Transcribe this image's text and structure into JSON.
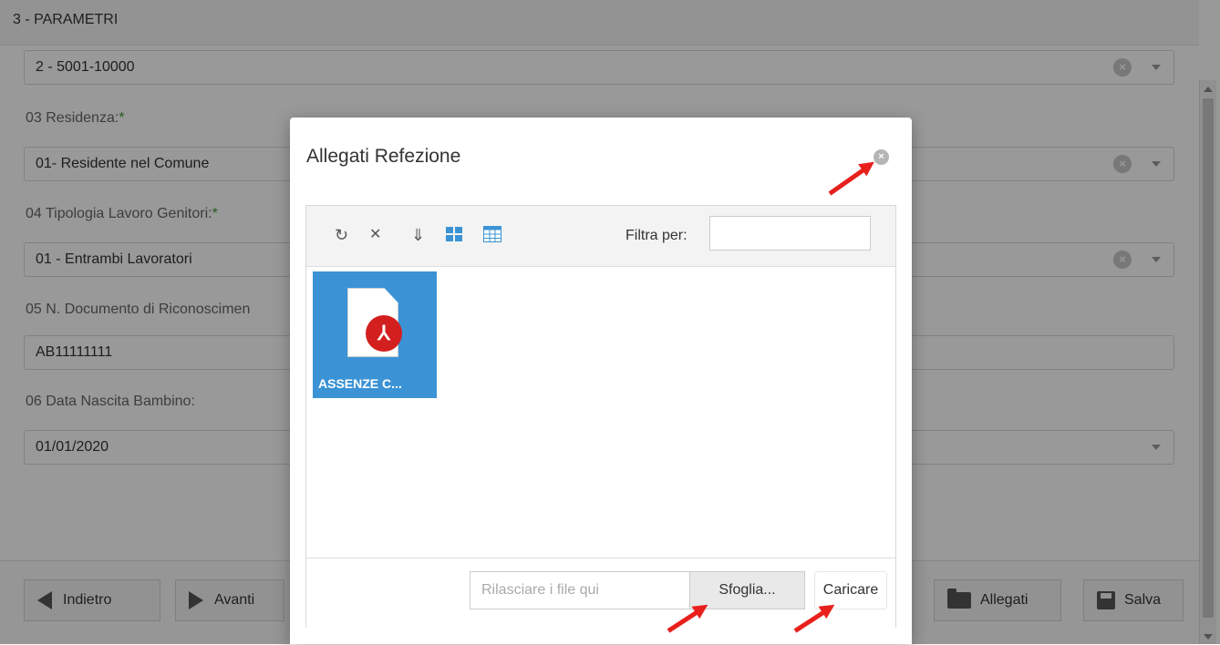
{
  "section": {
    "title": "3 - PARAMETRI"
  },
  "fields": {
    "f02_value": "2 - 5001-10000",
    "f03_label": "03 Residenza:",
    "f03_value": "01- Residente nel Comune",
    "f04_label": "04 Tipologia Lavoro Genitori:",
    "f04_value": "01 - Entrambi Lavoratori",
    "f05_label": "05 N. Documento di Riconoscimen",
    "f05_value": "AB11111111",
    "f06_label": "06 Data Nascita Bambino:",
    "f06_value": "01/01/2020",
    "required_mark": "*",
    "clear_glyph": "×"
  },
  "footer": {
    "back_label": "Indietro",
    "next_label": "Avanti",
    "attachments_label": "Allegati",
    "save_label": "Salva"
  },
  "modal": {
    "title": "Allegati Refezione",
    "close_glyph": "×",
    "toolbar": {
      "refresh_glyph": "↻",
      "delete_glyph": "✕",
      "download_glyph": "⇓",
      "filter_label": "Filtra per:",
      "filter_value": ""
    },
    "file": {
      "name": "ASSENZE C...",
      "badge": "⅄"
    },
    "upload": {
      "drop_placeholder": "Rilasciare i file qui",
      "browse_label": "Sfoglia...",
      "upload_label": "Caricare"
    }
  },
  "colors": {
    "tile": "#3b93d6",
    "pdf": "#d41f1f",
    "arrow": "#e8201c",
    "required": "#3a9a3a"
  }
}
